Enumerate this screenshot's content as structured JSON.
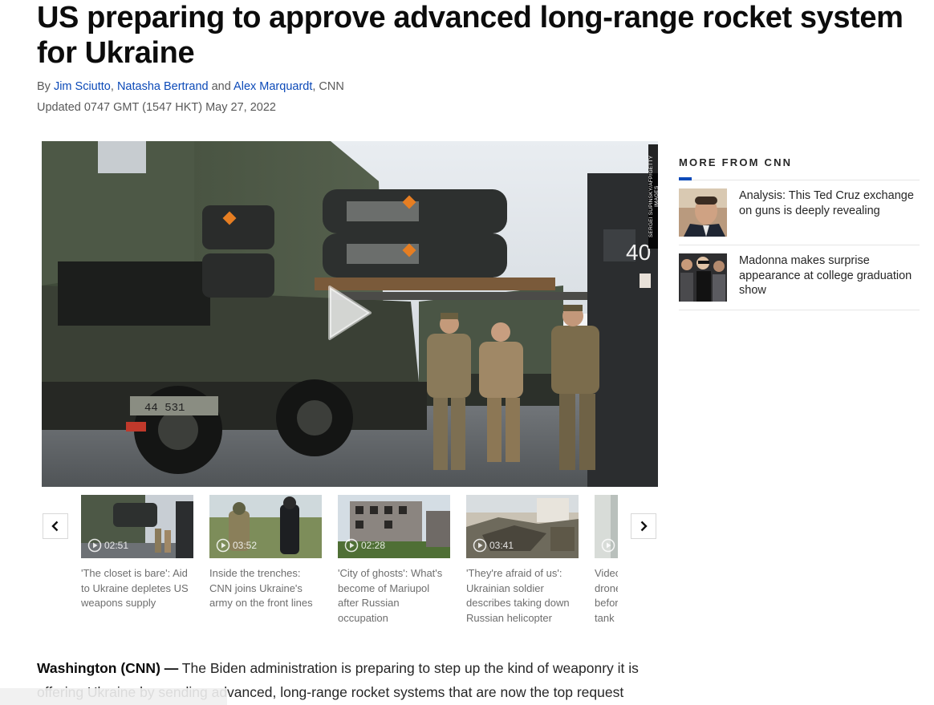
{
  "article": {
    "headline": "US preparing to approve advanced long-range rocket system for Ukraine",
    "byline_prefix": "By ",
    "authors": [
      "Jim Sciutto",
      "Natasha Bertrand",
      "Alex Marquardt"
    ],
    "byline_sep1": ", ",
    "byline_sep2": " and ",
    "byline_suffix": ", CNN",
    "updated": "Updated 0747 GMT (1547 HKT) May 27, 2022",
    "photo_credit": "SERGEI SUPINSKY/AFP/GETTY IMAGES",
    "dateline": "Washington (CNN) —",
    "lede": " The Biden administration is preparing to step up the kind of weaponry it is offering Ukraine by sending advanced, long-range rocket systems that are now the top request"
  },
  "hero_marks": {
    "truck_plate": "44 531",
    "loader_number": "40"
  },
  "sidebar": {
    "title": "MORE FROM CNN",
    "stories": [
      {
        "text": "Analysis: This Ted Cruz exchange on guns is deeply revealing"
      },
      {
        "text": "Madonna makes surprise appearance at college graduation show"
      }
    ]
  },
  "carousel": {
    "cards": [
      {
        "duration": "02:51",
        "caption": "'The closet is bare': Aid to Ukraine depletes US weapons supply"
      },
      {
        "duration": "03:52",
        "caption": "Inside the trenches: CNN joins Ukraine's army on the front lines"
      },
      {
        "duration": "02:28",
        "caption": "'City of ghosts': What's become of Mariupol after Russian occupation"
      },
      {
        "duration": "03:41",
        "caption": "'They're afraid of us': Ukrainian soldier describes taking down Russian helicopter"
      },
      {
        "duration": "",
        "caption": "Video drone befor tank"
      }
    ]
  },
  "colors": {
    "link": "#0c4ab8",
    "accent_rule": "#0c4ab8",
    "text": "#262626",
    "muted": "#595959"
  }
}
